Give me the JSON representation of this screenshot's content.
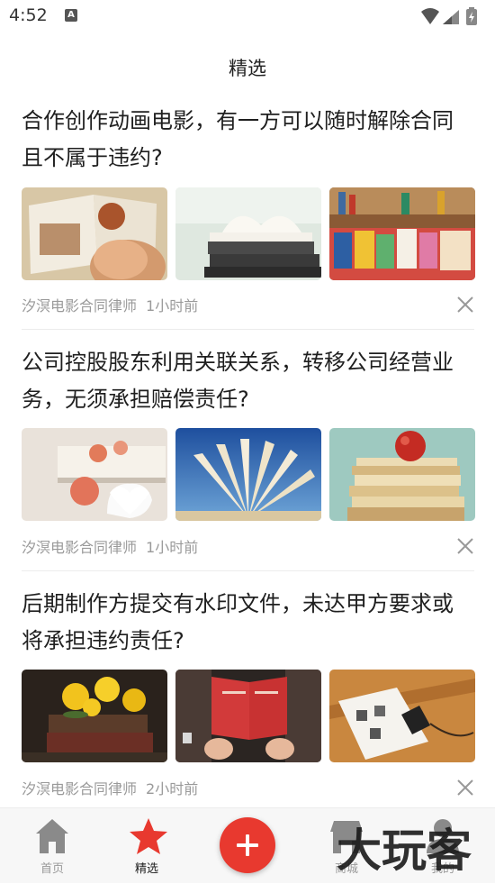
{
  "status_bar": {
    "time": "4:52",
    "notification_icon": "A"
  },
  "page": {
    "title": "精选"
  },
  "articles": [
    {
      "title": "合作创作动画电影，有一方可以随时解除合同且不属于违约?",
      "source": "汐溟电影合同律师",
      "time": "1小时前"
    },
    {
      "title": "公司控股股东利用关联关系，转移公司经营业务，无须承担赔偿责任?",
      "source": "汐溟电影合同律师",
      "time": "1小时前"
    },
    {
      "title": "后期制作方提交有水印文件，未达甲方要求或将承担违约责任?",
      "source": "汐溟电影合同律师",
      "time": "2小时前"
    }
  ],
  "tabs": [
    {
      "label": "首页",
      "icon": "home-icon"
    },
    {
      "label": "精选",
      "icon": "star-icon"
    },
    {
      "label": "",
      "icon": "plus-icon"
    },
    {
      "label": "商城",
      "icon": "shop-icon"
    },
    {
      "label": "我的",
      "icon": "user-icon"
    }
  ],
  "watermark": {
    "text": "大玩客"
  },
  "colors": {
    "accent": "#e8392f",
    "meta": "#9a9a9a",
    "tab_inactive": "#999999"
  }
}
